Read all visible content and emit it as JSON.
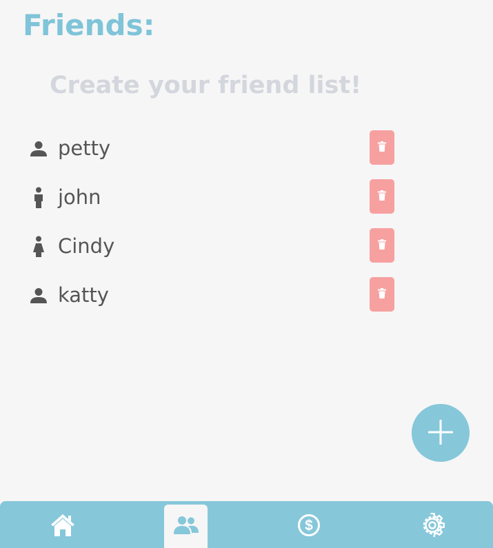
{
  "header": {
    "title": "Friends:",
    "subtitle": "Create your friend list!"
  },
  "friends": [
    {
      "name": "petty",
      "icon": "person-icon"
    },
    {
      "name": "john",
      "icon": "man-icon"
    },
    {
      "name": "Cindy",
      "icon": "woman-icon"
    },
    {
      "name": "katty",
      "icon": "person-icon"
    }
  ],
  "actions": {
    "delete_icon": "trash-icon",
    "add_icon": "plus-icon"
  },
  "nav": {
    "items": [
      {
        "id": "home",
        "icon": "home-icon",
        "active": false
      },
      {
        "id": "friends",
        "icon": "people-icon",
        "active": true
      },
      {
        "id": "money",
        "icon": "dollar-circle-icon",
        "active": false
      },
      {
        "id": "settings",
        "icon": "gear-icon",
        "active": false
      }
    ]
  },
  "colors": {
    "accent": "#86c7da",
    "title": "#7fc4d8",
    "subtitle": "#d3d6dc",
    "delete": "#f7a0a0",
    "text": "#555555",
    "background": "#f6f6f6"
  }
}
